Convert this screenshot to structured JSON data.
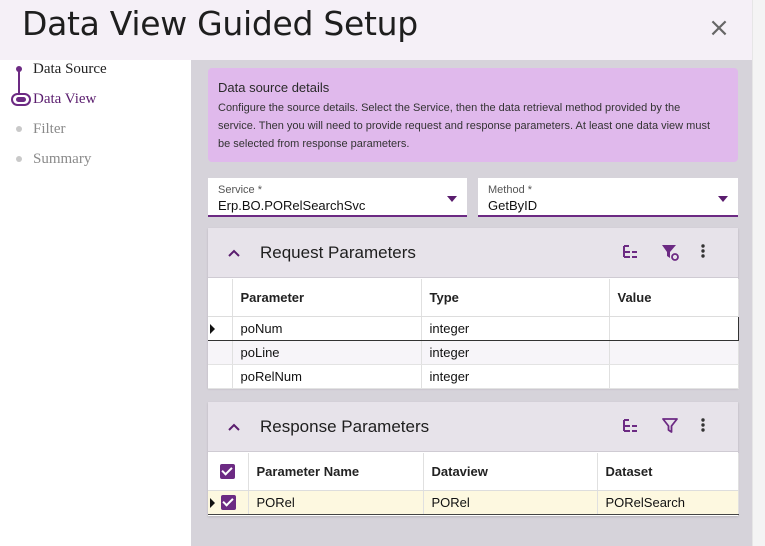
{
  "dialog": {
    "title": "Data View Guided Setup",
    "close_icon": "×"
  },
  "steps": [
    {
      "label": "Data Source",
      "state": "done"
    },
    {
      "label": "Data View",
      "state": "current"
    },
    {
      "label": "Filter",
      "state": "todo"
    },
    {
      "label": "Summary",
      "state": "todo"
    }
  ],
  "info": {
    "title": "Data source details",
    "lines": [
      "Configure the source details. Select the Service, then the data retrieval method provided by the",
      "service. Then you will need to provide request and response parameters. At least one data view must",
      "be selected from response parameters."
    ]
  },
  "service": {
    "label": "Service *",
    "value": "Erp.BO.PORelSearchSvc"
  },
  "method": {
    "label": "Method *",
    "value": "GetByID"
  },
  "request": {
    "title": "Request Parameters",
    "columns": [
      "Parameter",
      "Type",
      "Value"
    ],
    "rows": [
      {
        "parameter": "poNum",
        "type": "integer",
        "value": ""
      },
      {
        "parameter": "poLine",
        "type": "integer",
        "value": ""
      },
      {
        "parameter": "poRelNum",
        "type": "integer",
        "value": ""
      }
    ]
  },
  "response": {
    "title": "Response Parameters",
    "columns": [
      "Parameter Name",
      "Dataview",
      "Dataset"
    ],
    "rows": [
      {
        "name": "PORel",
        "dataview": "PORel",
        "dataset": "PORelSearch",
        "checked": true
      }
    ]
  },
  "colors": {
    "accent": "#6c2a83",
    "info_bg": "#e0b9ec",
    "main_bg": "#d6d3da",
    "header_bg": "#f5f0f7",
    "selected_row": "#fdf8e0"
  },
  "icons": {
    "close": "close-icon",
    "collapse": "chevron-up-icon",
    "tree": "tree-structure-icon",
    "filter_settings": "filter-settings-icon",
    "filter": "filter-icon",
    "more": "more-vertical-icon"
  }
}
